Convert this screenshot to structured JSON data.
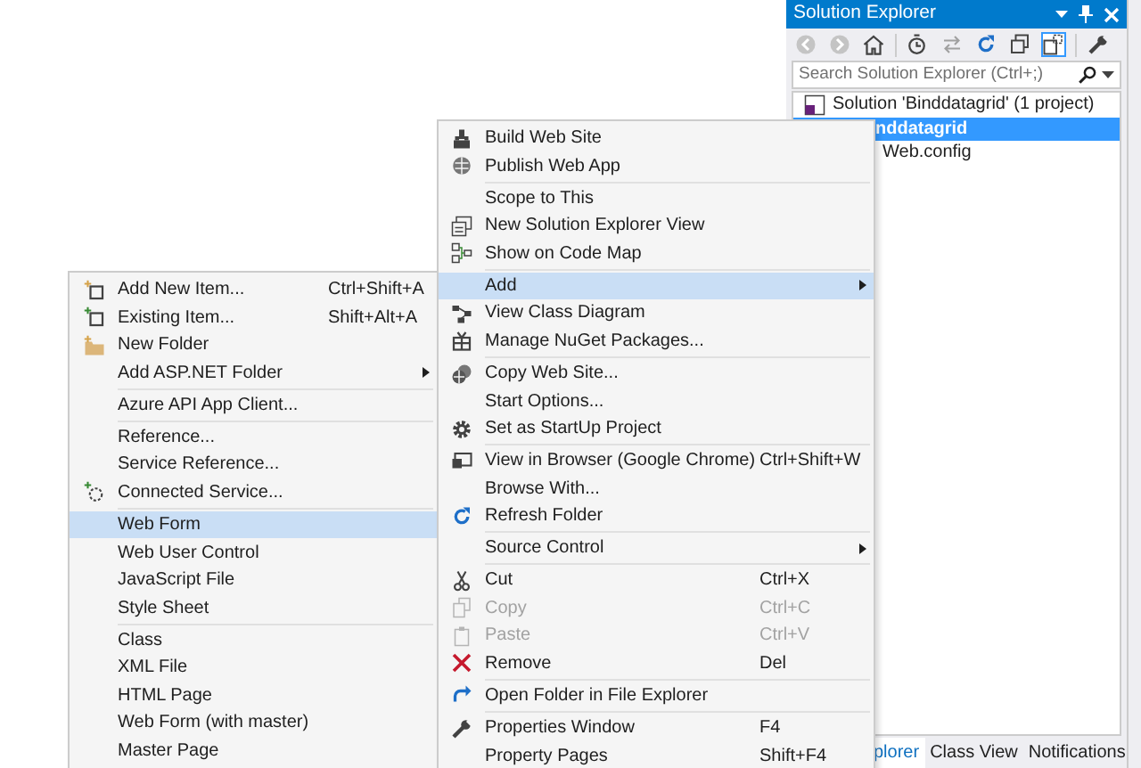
{
  "solution_explorer": {
    "title": "Solution Explorer",
    "search": {
      "placeholder": "Search Solution Explorer (Ctrl+;)"
    },
    "tree": [
      {
        "label": "Solution 'Binddatagrid' (1 project)",
        "selected": false,
        "children": [
          {
            "label": "nddatagrid",
            "selected": true,
            "children": [
              {
                "label": "Web.config",
                "selected": false
              }
            ]
          }
        ]
      }
    ],
    "tabs": [
      {
        "label": "plorer",
        "selected": true
      },
      {
        "label": "Class View",
        "selected": false
      },
      {
        "label": "Notifications",
        "selected": false
      }
    ]
  },
  "context_menu": {
    "items": [
      {
        "kind": "item",
        "label": "Build Web Site",
        "selected": false,
        "disabled": false,
        "submenu": false
      },
      {
        "kind": "item",
        "label": "Publish Web App",
        "selected": false,
        "disabled": false,
        "submenu": false
      },
      {
        "kind": "separator"
      },
      {
        "kind": "item",
        "label": "Scope to This",
        "selected": false,
        "disabled": false,
        "submenu": false
      },
      {
        "kind": "item",
        "label": "New Solution Explorer View",
        "selected": false,
        "disabled": false,
        "submenu": false
      },
      {
        "kind": "item",
        "label": "Show on Code Map",
        "selected": false,
        "disabled": false,
        "submenu": false
      },
      {
        "kind": "separator"
      },
      {
        "kind": "item",
        "label": "Add",
        "selected": true,
        "disabled": false,
        "submenu": true
      },
      {
        "kind": "item",
        "label": "View Class Diagram",
        "selected": false,
        "disabled": false,
        "submenu": false
      },
      {
        "kind": "item",
        "label": "Manage NuGet Packages...",
        "selected": false,
        "disabled": false,
        "submenu": false
      },
      {
        "kind": "separator"
      },
      {
        "kind": "item",
        "label": "Copy Web Site...",
        "selected": false,
        "disabled": false,
        "submenu": false
      },
      {
        "kind": "item",
        "label": "Start Options...",
        "selected": false,
        "disabled": false,
        "submenu": false
      },
      {
        "kind": "item",
        "label": "Set as StartUp Project",
        "selected": false,
        "disabled": false,
        "submenu": false
      },
      {
        "kind": "separator"
      },
      {
        "kind": "item",
        "label": "View in Browser (Google Chrome)",
        "shortcut": "Ctrl+Shift+W",
        "selected": false,
        "disabled": false,
        "submenu": false
      },
      {
        "kind": "item",
        "label": "Browse With...",
        "selected": false,
        "disabled": false,
        "submenu": false
      },
      {
        "kind": "item",
        "label": "Refresh Folder",
        "selected": false,
        "disabled": false,
        "submenu": false
      },
      {
        "kind": "separator"
      },
      {
        "kind": "item",
        "label": "Source Control",
        "selected": false,
        "disabled": false,
        "submenu": true
      },
      {
        "kind": "separator"
      },
      {
        "kind": "item",
        "label": "Cut",
        "shortcut": "Ctrl+X",
        "selected": false,
        "disabled": false,
        "submenu": false
      },
      {
        "kind": "item",
        "label": "Copy",
        "shortcut": "Ctrl+C",
        "selected": false,
        "disabled": true,
        "submenu": false
      },
      {
        "kind": "item",
        "label": "Paste",
        "shortcut": "Ctrl+V",
        "selected": false,
        "disabled": true,
        "submenu": false
      },
      {
        "kind": "item",
        "label": "Remove",
        "shortcut": "Del",
        "selected": false,
        "disabled": false,
        "submenu": false
      },
      {
        "kind": "separator"
      },
      {
        "kind": "item",
        "label": "Open Folder in File Explorer",
        "selected": false,
        "disabled": false,
        "submenu": false
      },
      {
        "kind": "separator"
      },
      {
        "kind": "item",
        "label": "Properties Window",
        "shortcut": "F4",
        "selected": false,
        "disabled": false,
        "submenu": false
      },
      {
        "kind": "item",
        "label": "Property Pages",
        "shortcut": "Shift+F4",
        "selected": false,
        "disabled": false,
        "submenu": false
      }
    ]
  },
  "add_submenu": {
    "items": [
      {
        "kind": "item",
        "label": "Add New Item...",
        "shortcut": "Ctrl+Shift+A",
        "selected": false,
        "disabled": false,
        "submenu": false
      },
      {
        "kind": "item",
        "label": "Existing Item...",
        "shortcut": "Shift+Alt+A",
        "selected": false,
        "disabled": false,
        "submenu": false
      },
      {
        "kind": "item",
        "label": "New Folder",
        "selected": false,
        "disabled": false,
        "submenu": false
      },
      {
        "kind": "item",
        "label": "Add ASP.NET Folder",
        "selected": false,
        "disabled": false,
        "submenu": true
      },
      {
        "kind": "separator"
      },
      {
        "kind": "item",
        "label": "Azure API App Client...",
        "selected": false,
        "disabled": false,
        "submenu": false
      },
      {
        "kind": "separator"
      },
      {
        "kind": "item",
        "label": "Reference...",
        "selected": false,
        "disabled": false,
        "submenu": false
      },
      {
        "kind": "item",
        "label": "Service Reference...",
        "selected": false,
        "disabled": false,
        "submenu": false
      },
      {
        "kind": "item",
        "label": "Connected Service...",
        "selected": false,
        "disabled": false,
        "submenu": false
      },
      {
        "kind": "separator"
      },
      {
        "kind": "item",
        "label": "Web Form",
        "selected": true,
        "disabled": false,
        "submenu": false
      },
      {
        "kind": "item",
        "label": "Web User Control",
        "selected": false,
        "disabled": false,
        "submenu": false
      },
      {
        "kind": "item",
        "label": "JavaScript File",
        "selected": false,
        "disabled": false,
        "submenu": false
      },
      {
        "kind": "item",
        "label": "Style Sheet",
        "selected": false,
        "disabled": false,
        "submenu": false
      },
      {
        "kind": "separator"
      },
      {
        "kind": "item",
        "label": "Class",
        "selected": false,
        "disabled": false,
        "submenu": false
      },
      {
        "kind": "item",
        "label": "XML File",
        "selected": false,
        "disabled": false,
        "submenu": false
      },
      {
        "kind": "item",
        "label": "HTML Page",
        "selected": false,
        "disabled": false,
        "submenu": false
      },
      {
        "kind": "item",
        "label": "Web Form (with master)",
        "selected": false,
        "disabled": false,
        "submenu": false
      },
      {
        "kind": "item",
        "label": "Master Page",
        "selected": false,
        "disabled": false,
        "submenu": false
      }
    ]
  }
}
